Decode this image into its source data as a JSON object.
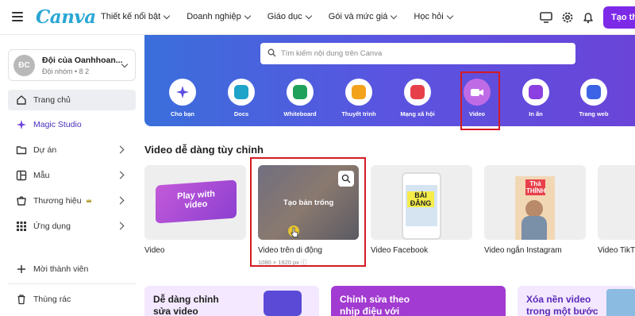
{
  "topbar": {
    "logo": "Canva",
    "nav": [
      {
        "label": "Thiết kế nổi bật"
      },
      {
        "label": "Doanh nghiệp"
      },
      {
        "label": "Giáo dục"
      },
      {
        "label": "Gói và mức giá"
      },
      {
        "label": "Học hỏi"
      }
    ],
    "cta_label": "Tạo th",
    "icons": [
      "monitor-icon",
      "gear-icon",
      "bell-icon"
    ]
  },
  "sidebar": {
    "team": {
      "avatar": "ĐC",
      "name": "Đội của Oanhhoan...",
      "sub": "Đội nhóm • 8 2"
    },
    "items": [
      {
        "label": "Trang chủ",
        "icon": "home-icon",
        "active": true
      },
      {
        "label": "Magic Studio",
        "icon": "sparkle-icon"
      },
      {
        "label": "Dự án",
        "icon": "folder-icon",
        "arrow": true
      },
      {
        "label": "Mẫu",
        "icon": "template-icon",
        "arrow": true
      },
      {
        "label": "Thương hiệu",
        "icon": "brand-icon",
        "arrow": true
      },
      {
        "label": "Ứng dụng",
        "icon": "apps-grid-icon",
        "arrow": true
      },
      {
        "label": "Mời thành viên",
        "icon": "plus-icon"
      },
      {
        "label": "Thùng rác",
        "icon": "trash-icon"
      }
    ]
  },
  "hero": {
    "search_placeholder": "Tìm kiếm nội dung trên Canva",
    "categories": [
      {
        "label": "Cho bạn",
        "color": "#5b4ee0"
      },
      {
        "label": "Docs",
        "color": "#1ea3c9"
      },
      {
        "label": "Whiteboard",
        "color": "#1fa15b"
      },
      {
        "label": "Thuyết trình",
        "color": "#f3a21c"
      },
      {
        "label": "Mạng xã hội",
        "color": "#e8404a"
      },
      {
        "label": "Video",
        "color": "#a24fd6",
        "selected": true
      },
      {
        "label": "In ấn",
        "color": "#8b3fe0"
      },
      {
        "label": "Trang web",
        "color": "#3c63e5"
      }
    ]
  },
  "templates": {
    "title": "Video dễ dàng tùy chỉnh",
    "card1_text": "Play with video",
    "card2_hover": "Tạo bản trống",
    "card3_text": "BÀI ĐĂNG",
    "card4_text": "Thả THÍNH",
    "items": [
      {
        "label": "Video"
      },
      {
        "label": "Video trên di động",
        "meta": "1080 × 1920 px ⓘ"
      },
      {
        "label": "Video Facebook"
      },
      {
        "label": "Video ngắn Instagram"
      },
      {
        "label": "Video TikT"
      }
    ]
  },
  "promos": [
    {
      "text1": "Dễ dàng chỉnh",
      "text2": "sửa video"
    },
    {
      "text1": "Chỉnh sửa theo",
      "text2": "nhịp điệu với"
    },
    {
      "text1": "Xóa nền video",
      "text2": "trong một bước"
    }
  ],
  "colors": {
    "accent": "#7d2ae8",
    "highlight": "#d31b24",
    "hero_start": "#3a6fdb",
    "hero_end": "#6a44d8"
  }
}
